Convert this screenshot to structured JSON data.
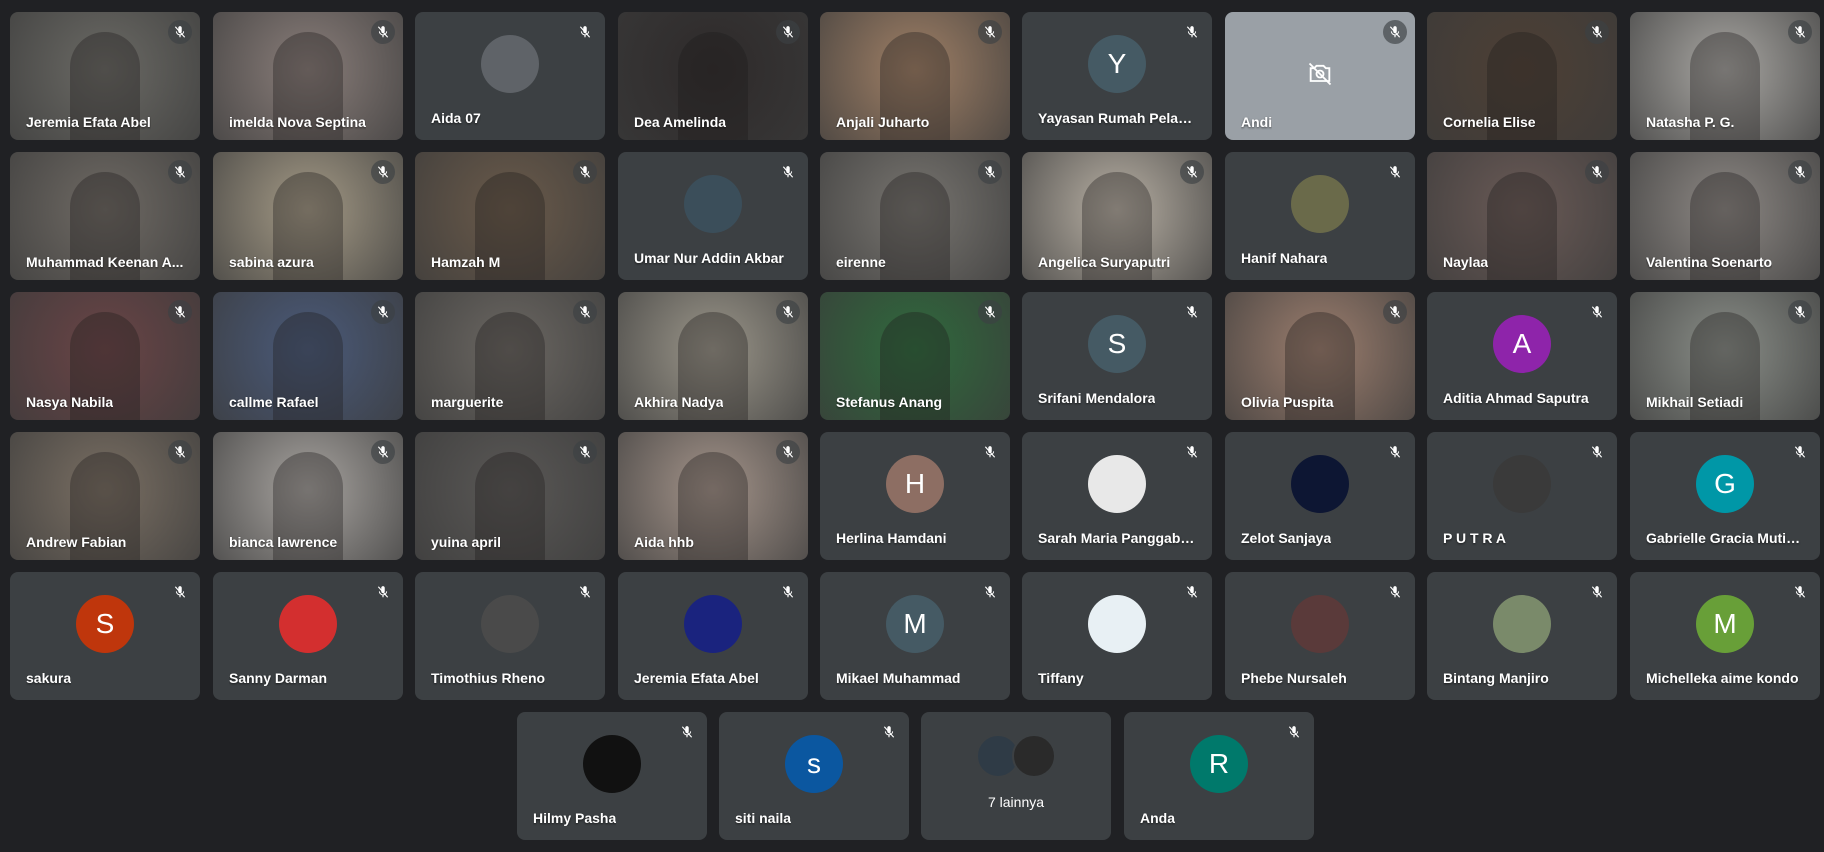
{
  "participants": [
    {
      "name": "Jeremia Efata Abel",
      "type": "video",
      "bg": "#6b6a65"
    },
    {
      "name": "imelda Nova Septina",
      "type": "video",
      "bg": "#8a7e7a"
    },
    {
      "name": "Aida 07",
      "type": "avatar",
      "icon": "photo",
      "color": "#5f6368"
    },
    {
      "name": "Dea Amelinda",
      "type": "video",
      "bg": "#2e2a2a"
    },
    {
      "name": "Anjali Juharto",
      "type": "video",
      "bg": "#a08066"
    },
    {
      "name": "Yayasan Rumah Pelangi...",
      "type": "avatar",
      "letter": "Y",
      "color": "#455a64"
    },
    {
      "name": "Andi",
      "type": "camoff",
      "bg": "#9aa0a6"
    },
    {
      "name": "Cornelia Elise",
      "type": "video",
      "bg": "#4e4035"
    },
    {
      "name": "Natasha P. G.",
      "type": "video",
      "bg": "#a9a7a3"
    },
    {
      "name": "Muhammad Keenan A...",
      "type": "video",
      "bg": "#6f6a64"
    },
    {
      "name": "sabina azura",
      "type": "video",
      "bg": "#a49a86"
    },
    {
      "name": "Hamzah M",
      "type": "video",
      "bg": "#6a5a4a"
    },
    {
      "name": "Umar Nur Addin Akbar",
      "type": "avatar",
      "icon": "photo",
      "color": "#3b4e5a"
    },
    {
      "name": "eirenne",
      "type": "video",
      "bg": "#787570"
    },
    {
      "name": "Angelica Suryaputri",
      "type": "video",
      "bg": "#b8b0a4"
    },
    {
      "name": "Hanif Nahara",
      "type": "avatar",
      "icon": "photo",
      "color": "#6a6a4a"
    },
    {
      "name": "Naylaa",
      "type": "video",
      "bg": "#6a5a56"
    },
    {
      "name": "Valentina Soenarto",
      "type": "video",
      "bg": "#8d8884"
    },
    {
      "name": "Nasya Nabila",
      "type": "video",
      "bg": "#6a4446"
    },
    {
      "name": "callme Rafael",
      "type": "video",
      "bg": "#4a5a7a"
    },
    {
      "name": "marguerite",
      "type": "video",
      "bg": "#6b6762"
    },
    {
      "name": "Akhira Nadya",
      "type": "video",
      "bg": "#9b968a"
    },
    {
      "name": "Stefanus Anang",
      "type": "video",
      "bg": "#2f6a3c"
    },
    {
      "name": "Srifani Mendalora",
      "type": "avatar",
      "letter": "S",
      "color": "#455a64"
    },
    {
      "name": "Olivia Puspita",
      "type": "video",
      "bg": "#9c7e6e"
    },
    {
      "name": "Aditia Ahmad Saputra",
      "type": "avatar",
      "letter": "A",
      "color": "#8e24aa"
    },
    {
      "name": "Mikhail Setiadi",
      "type": "video",
      "bg": "#8a8e88"
    },
    {
      "name": "Andrew Fabian",
      "type": "video",
      "bg": "#7a6f63"
    },
    {
      "name": "bianca lawrence",
      "type": "video",
      "bg": "#a8a4a0"
    },
    {
      "name": "yuina april",
      "type": "video",
      "bg": "#5a5856"
    },
    {
      "name": "Aida hhb",
      "type": "video",
      "bg": "#a4948a"
    },
    {
      "name": "Herlina Hamdani",
      "type": "avatar",
      "letter": "H",
      "color": "#8d6e63"
    },
    {
      "name": "Sarah Maria Panggabean",
      "type": "avatar",
      "icon": "photo",
      "color": "#e8e8e8"
    },
    {
      "name": "Zelot Sanjaya",
      "type": "avatar",
      "icon": "photo",
      "color": "#0d1633"
    },
    {
      "name": "P U T R A",
      "type": "avatar",
      "icon": "photo",
      "color": "#3a3a3a"
    },
    {
      "name": "Gabrielle Gracia Mutiar...",
      "type": "avatar",
      "letter": "G",
      "color": "#0097a7"
    },
    {
      "name": "sakura",
      "type": "avatar",
      "letter": "S",
      "color": "#bf360c"
    },
    {
      "name": "Sanny Darman",
      "type": "avatar",
      "icon": "photo",
      "color": "#d32f2f"
    },
    {
      "name": "Timothius Rheno",
      "type": "avatar",
      "icon": "photo",
      "color": "#4a4a4a"
    },
    {
      "name": "Jeremia Efata Abel",
      "type": "avatar",
      "icon": "photo",
      "color": "#1a237e"
    },
    {
      "name": "Mikael Muhammad",
      "type": "avatar",
      "letter": "M",
      "color": "#455a64"
    },
    {
      "name": "Tiffany",
      "type": "avatar",
      "icon": "photo",
      "color": "#e8f0f4"
    },
    {
      "name": "Phebe Nursaleh",
      "type": "avatar",
      "icon": "photo",
      "color": "#5a3a3a"
    },
    {
      "name": "Bintang Manjiro",
      "type": "avatar",
      "icon": "photo",
      "color": "#7a8a6a"
    },
    {
      "name": "Michelleka aime kondo",
      "type": "avatar",
      "letter": "M",
      "color": "#689f38"
    },
    {
      "name": "Hilmy Pasha",
      "type": "avatar",
      "icon": "photo",
      "color": "#111111"
    },
    {
      "name": "siti naila",
      "type": "avatar",
      "letter": "s",
      "color": "#0b57a0"
    },
    {
      "name": "7 lainnya",
      "type": "more"
    },
    {
      "name": "Anda",
      "type": "avatar",
      "letter": "R",
      "color": "#00796b"
    }
  ]
}
